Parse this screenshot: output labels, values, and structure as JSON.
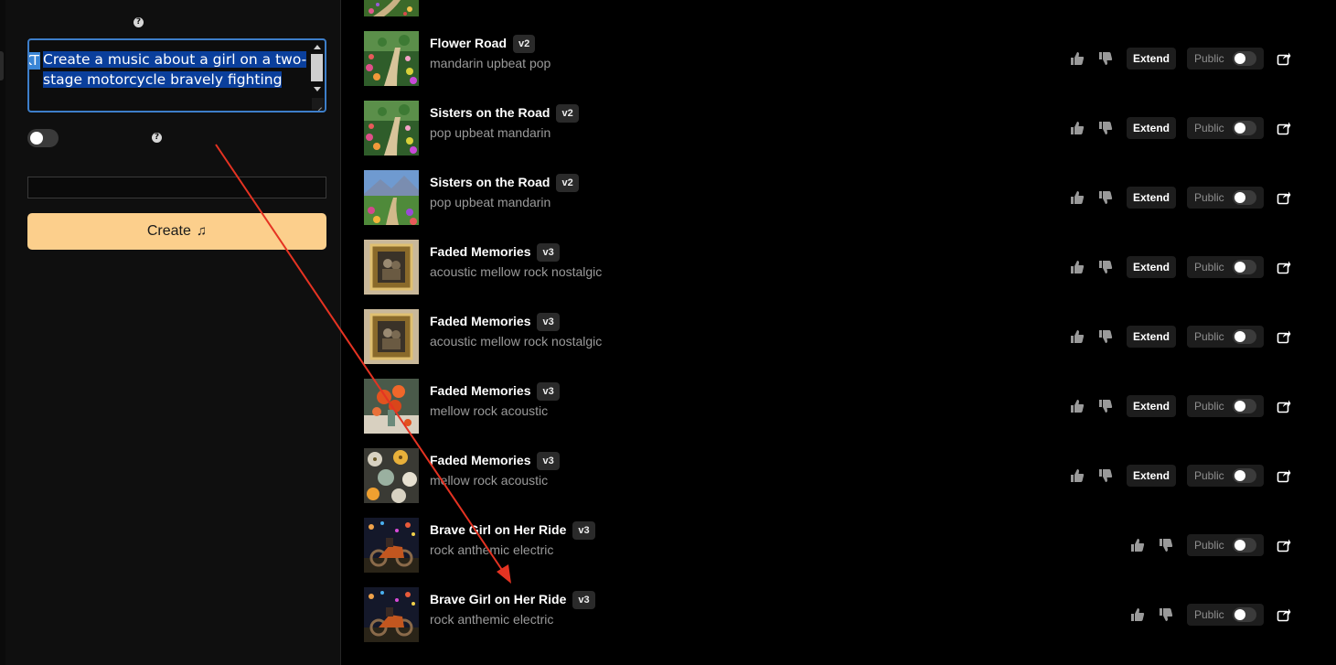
{
  "left_panel": {
    "prompt_text": "Create a music about a girl on a two-stage motorcycle bravely fighting",
    "prompt_badge": "KT",
    "help_glyph": "?",
    "create_label": "Create",
    "create_icon": "music-note-plus-icon"
  },
  "colors": {
    "background": "#000000",
    "create_button": "#fccf8c",
    "focus_border": "#3d7ec9",
    "annotation_arrow": "#e53322"
  },
  "songs": [
    {
      "title": "Flower Road",
      "version": "v2",
      "style": "mandarin upbeat pop",
      "extend": "Extend",
      "public": "Public",
      "art": "flower-path"
    },
    {
      "title": "Sisters on the Road",
      "version": "v2",
      "style": "pop upbeat mandarin",
      "extend": "Extend",
      "public": "Public",
      "art": "flower-path"
    },
    {
      "title": "Sisters on the Road",
      "version": "v2",
      "style": "pop upbeat mandarin",
      "extend": "Extend",
      "public": "Public",
      "art": "mountain-path"
    },
    {
      "title": "Faded Memories",
      "version": "v3",
      "style": "acoustic mellow rock nostalgic",
      "extend": "Extend",
      "public": "Public",
      "art": "frame"
    },
    {
      "title": "Faded Memories",
      "version": "v3",
      "style": "acoustic mellow rock nostalgic",
      "extend": "Extend",
      "public": "Public",
      "art": "frame"
    },
    {
      "title": "Faded Memories",
      "version": "v3",
      "style": "mellow rock acoustic",
      "extend": "Extend",
      "public": "Public",
      "art": "poppies"
    },
    {
      "title": "Faded Memories",
      "version": "v3",
      "style": "mellow rock acoustic",
      "extend": "Extend",
      "public": "Public",
      "art": "flower-pattern"
    },
    {
      "title": "Brave Girl on Her Ride",
      "version": "v3",
      "style": "rock anthemic electric",
      "extend": "",
      "public": "Public",
      "art": "motorcycle-night"
    },
    {
      "title": "Brave Girl on Her Ride",
      "version": "v3",
      "style": "rock anthemic electric",
      "extend": "",
      "public": "Public",
      "art": "motorcycle-night"
    }
  ]
}
